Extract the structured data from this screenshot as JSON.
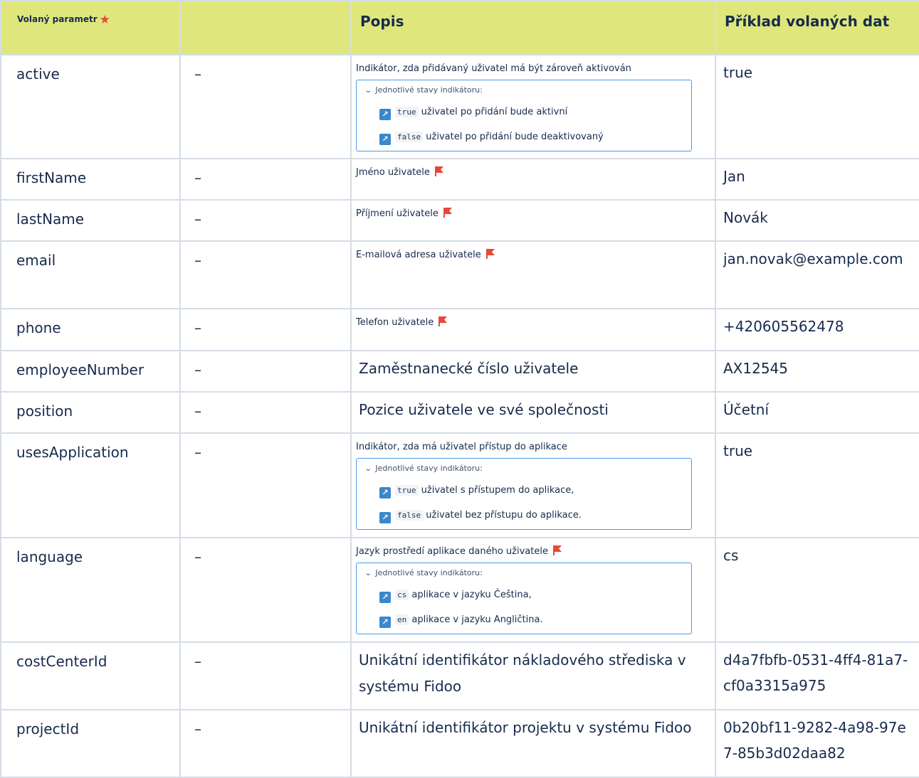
{
  "header": {
    "param": "Volaný parametr",
    "popis": "Popis",
    "priklad": "Příklad volaných dat"
  },
  "rows": [
    {
      "param": "active",
      "dash": "–",
      "desc": "Indikátor, zda přidávaný uživatel má být zároveň aktivován",
      "box_title": "Jednotlivé stavy indikátoru:",
      "states": [
        {
          "code": "true",
          "text": "uživatel po přidání bude aktivní"
        },
        {
          "code": "false",
          "text": "uživatel po přidání bude deaktivovaný"
        }
      ],
      "example": "true"
    },
    {
      "param": "firstName",
      "dash": "–",
      "desc": "Jméno uživatele",
      "example": "Jan"
    },
    {
      "param": "lastName",
      "dash": "–",
      "desc": "Příjmení uživatele",
      "example": "Novák"
    },
    {
      "param": "email",
      "dash": "–",
      "desc": "E-mailová adresa uživatele",
      "example": "jan.novak@example.com"
    },
    {
      "param": "phone",
      "dash": "–",
      "desc": "Telefon uživatele",
      "example": "+420605562478"
    },
    {
      "param": "employeeNumber",
      "dash": "–",
      "desc": "Zaměstnanecké číslo uživatele",
      "example": "AX12545"
    },
    {
      "param": "position",
      "dash": "–",
      "desc": "Pozice uživatele ve své společnosti",
      "example": "Účetní"
    },
    {
      "param": "usesApplication",
      "dash": "–",
      "desc": "Indikátor, zda má uživatel přístup do aplikace",
      "box_title": "Jednotlivé stavy indikátoru:",
      "states": [
        {
          "code": "true",
          "text": "uživatel s přístupem do aplikace,"
        },
        {
          "code": "false",
          "text": "uživatel bez přístupu do aplikace."
        }
      ],
      "example": "true"
    },
    {
      "param": "language",
      "dash": "–",
      "desc": "Jazyk prostředí aplikace daného uživatele",
      "box_title": "Jednotlivé stavy indikátoru:",
      "states": [
        {
          "code": "cs",
          "text": "aplikace v jazyku Čeština,"
        },
        {
          "code": "en",
          "text": "aplikace v jazyku Angličtina."
        }
      ],
      "example": "cs"
    },
    {
      "param": "costCenterId",
      "dash": "–",
      "desc": "Unikátní identifikátor nákladového střediska v systému Fidoo",
      "example": "d4a7fbfb-0531-4ff4-81a7-cf0a3315a975"
    },
    {
      "param": "projectId",
      "dash": "–",
      "desc": "Unikátní identifikátor projektu v systému Fidoo",
      "example": "0b20bf11-9282-4a98-97e7-85b3d02daa82"
    }
  ],
  "colors": {
    "header_bg": "#dfe77c",
    "star": "#e5493a",
    "flag": "#e5493a",
    "box_border": "#4c9be8",
    "arrow_icon": "#3b87cc"
  }
}
